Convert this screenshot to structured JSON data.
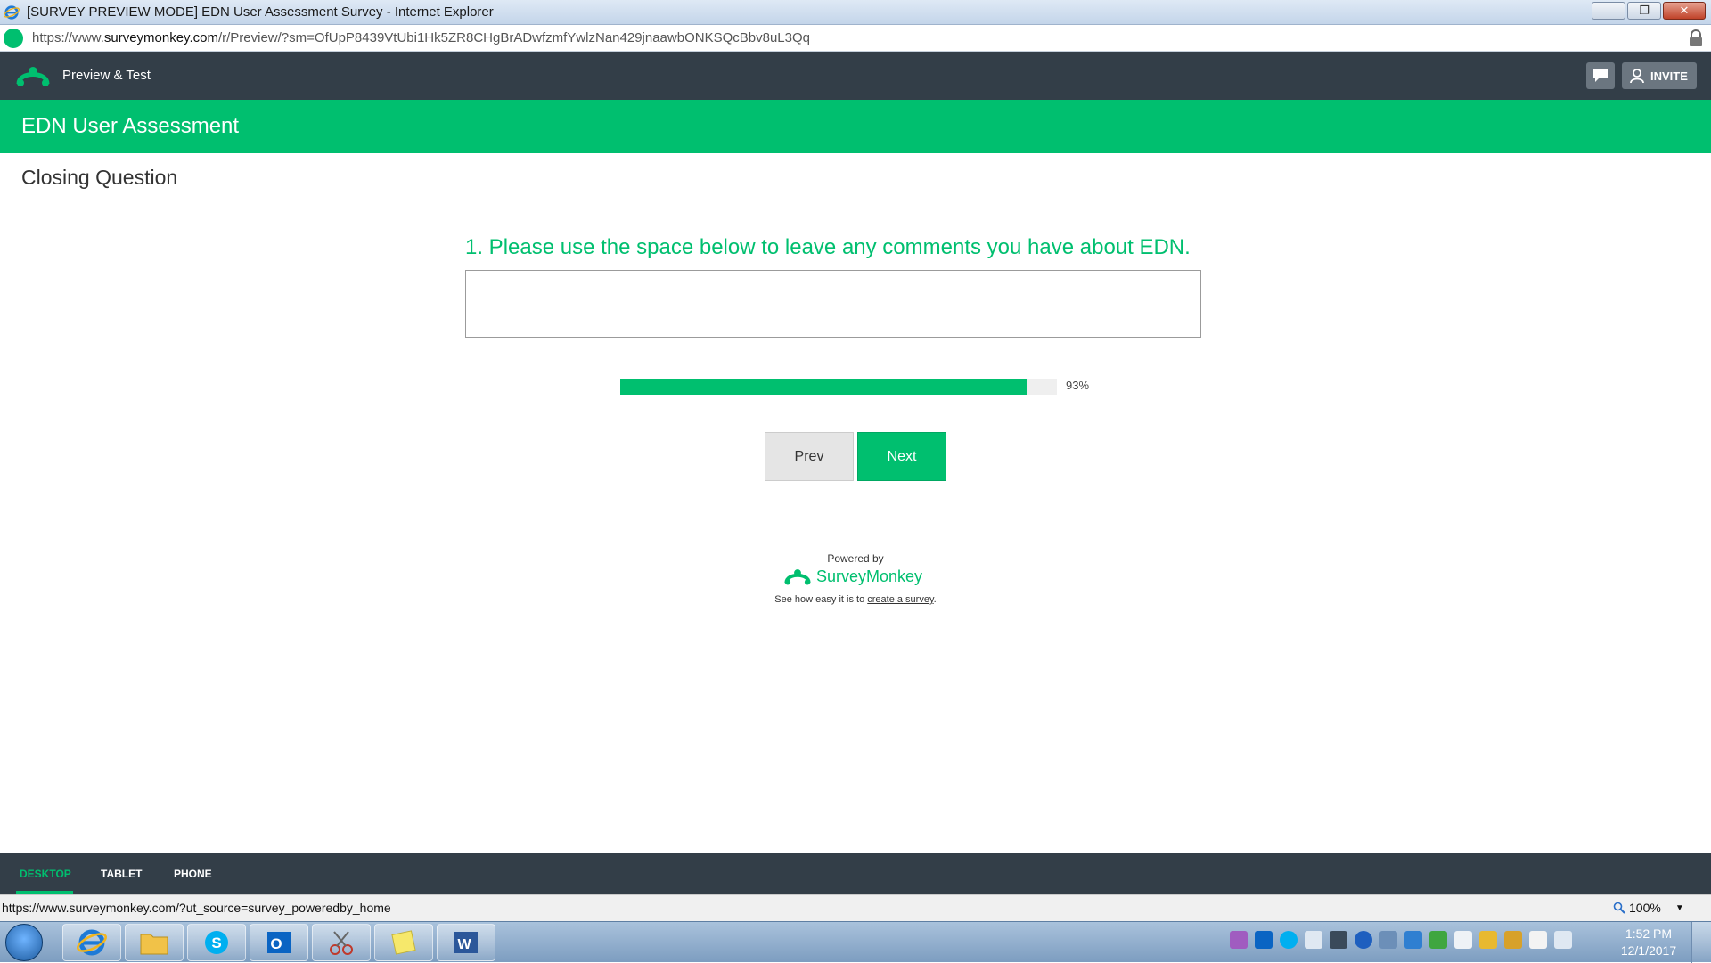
{
  "browser": {
    "window_title": "[SURVEY PREVIEW MODE] EDN User Assessment Survey - Internet Explorer",
    "url_scheme": "https://www.",
    "url_domain": "surveymonkey.com",
    "url_path": "/r/Preview/?sm=OfUpP8439VtUbi1Hk5ZR8CHgBrADwfzmfYwlzNan429jnaawbONKSQcBbv8uL3Qq",
    "status_url": "https://www.surveymonkey.com/?ut_source=survey_poweredby_home",
    "zoom": "100%"
  },
  "app_header": {
    "mode_label": "Preview & Test",
    "invite_label": "INVITE"
  },
  "survey": {
    "title": "EDN User Assessment",
    "page_title": "Closing Question",
    "question": "1. Please use the space below to leave any comments you have about EDN.",
    "answer_value": "",
    "progress_fraction": 0.93,
    "progress_label": "93%",
    "prev_label": "Prev",
    "next_label": "Next"
  },
  "footer": {
    "powered_by": "Powered by",
    "brand": "SurveyMonkey",
    "create_prefix": "See how easy it is to ",
    "create_link": "create a survey",
    "create_suffix": "."
  },
  "device_tabs": [
    "DESKTOP",
    "TABLET",
    "PHONE"
  ],
  "taskbar": {
    "time": "1:52 PM",
    "date": "12/1/2017",
    "apps": [
      "internet-explorer-icon",
      "file-explorer-icon",
      "skype-icon",
      "outlook-icon",
      "snipping-tool-icon",
      "sticky-notes-icon",
      "word-icon"
    ]
  },
  "colors": {
    "brand_green": "#00bf6f",
    "header_dark": "#333e48"
  }
}
